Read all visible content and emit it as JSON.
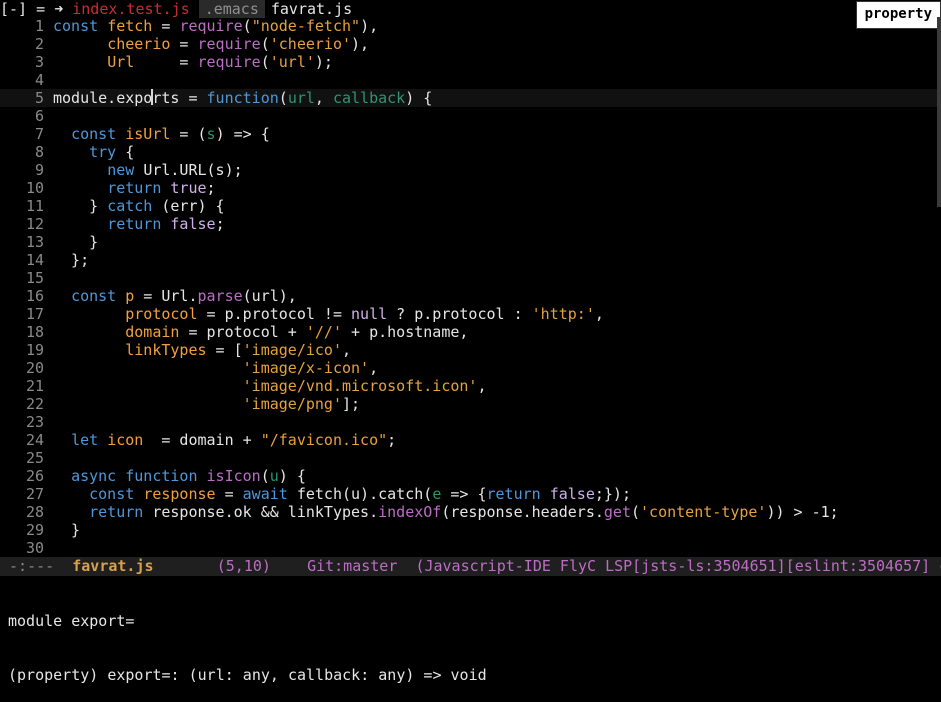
{
  "tabs": {
    "prefix": "[-] = ",
    "arrow": "➜",
    "items": [
      {
        "label": "index.test.js",
        "state": "modified"
      },
      {
        "label": ".emacs",
        "state": "inactive"
      },
      {
        "label": "favrat.js",
        "state": "current"
      }
    ]
  },
  "tooltip": {
    "text": "property"
  },
  "editor": {
    "current_line": 5,
    "line_numbers": [
      "1",
      "2",
      "3",
      "4",
      "5",
      "6",
      "7",
      "8",
      "9",
      "10",
      "11",
      "12",
      "13",
      "14",
      "15",
      "16",
      "17",
      "18",
      "19",
      "20",
      "21",
      "22",
      "23",
      "24",
      "25",
      "26",
      "27",
      "28",
      "29",
      "30"
    ],
    "lines": [
      [
        [
          "k",
          "const "
        ],
        [
          "v",
          "fetch"
        ],
        [
          "c",
          " = "
        ],
        [
          "f",
          "require"
        ],
        [
          "c",
          "("
        ],
        [
          "s",
          "\"node-fetch\""
        ],
        [
          "c",
          "),"
        ]
      ],
      [
        [
          "c",
          "      "
        ],
        [
          "v",
          "cheerio"
        ],
        [
          "c",
          " = "
        ],
        [
          "f",
          "require"
        ],
        [
          "c",
          "("
        ],
        [
          "s",
          "'cheerio'"
        ],
        [
          "c",
          "),"
        ]
      ],
      [
        [
          "c",
          "      "
        ],
        [
          "v",
          "Url"
        ],
        [
          "c",
          "     = "
        ],
        [
          "f",
          "require"
        ],
        [
          "c",
          "("
        ],
        [
          "s",
          "'url'"
        ],
        [
          "c",
          ");"
        ]
      ],
      [],
      [
        [
          "c",
          "module.expo"
        ],
        [
          "cursor",
          ""
        ],
        [
          "c",
          "rts = "
        ],
        [
          "k",
          "function"
        ],
        [
          "c",
          "("
        ],
        [
          "p",
          "url"
        ],
        [
          "c",
          ", "
        ],
        [
          "p",
          "callback"
        ],
        [
          "c",
          ") {"
        ]
      ],
      [],
      [
        [
          "c",
          "  "
        ],
        [
          "k",
          "const "
        ],
        [
          "v",
          "isUrl"
        ],
        [
          "c",
          " = ("
        ],
        [
          "p",
          "s"
        ],
        [
          "c",
          ") => {"
        ]
      ],
      [
        [
          "c",
          "    "
        ],
        [
          "k",
          "try"
        ],
        [
          "c",
          " {"
        ]
      ],
      [
        [
          "c",
          "      "
        ],
        [
          "k",
          "new "
        ],
        [
          "c",
          "Url.URL(s);"
        ]
      ],
      [
        [
          "c",
          "      "
        ],
        [
          "k",
          "return "
        ],
        [
          "kd",
          "true"
        ],
        [
          "c",
          ";"
        ]
      ],
      [
        [
          "c",
          "    } "
        ],
        [
          "k",
          "catch"
        ],
        [
          "c",
          " (err) {"
        ]
      ],
      [
        [
          "c",
          "      "
        ],
        [
          "k",
          "return "
        ],
        [
          "kd",
          "false"
        ],
        [
          "c",
          ";"
        ]
      ],
      [
        [
          "c",
          "    }"
        ]
      ],
      [
        [
          "c",
          "  };"
        ]
      ],
      [],
      [
        [
          "c",
          "  "
        ],
        [
          "k",
          "const "
        ],
        [
          "v",
          "p"
        ],
        [
          "c",
          " = Url."
        ],
        [
          "f",
          "parse"
        ],
        [
          "c",
          "(url),"
        ]
      ],
      [
        [
          "c",
          "        "
        ],
        [
          "v",
          "protocol"
        ],
        [
          "c",
          " = p.protocol != "
        ],
        [
          "kd",
          "null"
        ],
        [
          "c",
          " ? p.protocol : "
        ],
        [
          "s",
          "'http:'"
        ],
        [
          "c",
          ","
        ]
      ],
      [
        [
          "c",
          "        "
        ],
        [
          "v",
          "domain"
        ],
        [
          "c",
          " = protocol + "
        ],
        [
          "s",
          "'//'"
        ],
        [
          "c",
          " + p.hostname,"
        ]
      ],
      [
        [
          "c",
          "        "
        ],
        [
          "v",
          "linkTypes"
        ],
        [
          "c",
          " = ["
        ],
        [
          "s",
          "'image/ico'"
        ],
        [
          "c",
          ","
        ]
      ],
      [
        [
          "c",
          "                     "
        ],
        [
          "s",
          "'image/x-icon'"
        ],
        [
          "c",
          ","
        ]
      ],
      [
        [
          "c",
          "                     "
        ],
        [
          "s",
          "'image/vnd.microsoft.icon'"
        ],
        [
          "c",
          ","
        ]
      ],
      [
        [
          "c",
          "                     "
        ],
        [
          "s",
          "'image/png'"
        ],
        [
          "c",
          "];"
        ]
      ],
      [],
      [
        [
          "c",
          "  "
        ],
        [
          "k",
          "let "
        ],
        [
          "v",
          "icon"
        ],
        [
          "c",
          "  = domain + "
        ],
        [
          "s",
          "\"/favicon.ico\""
        ],
        [
          "c",
          ";"
        ]
      ],
      [],
      [
        [
          "c",
          "  "
        ],
        [
          "k",
          "async function "
        ],
        [
          "f",
          "isIcon"
        ],
        [
          "c",
          "("
        ],
        [
          "p",
          "u"
        ],
        [
          "c",
          ") {"
        ]
      ],
      [
        [
          "c",
          "    "
        ],
        [
          "k",
          "const "
        ],
        [
          "v",
          "response"
        ],
        [
          "c",
          " = "
        ],
        [
          "k",
          "await "
        ],
        [
          "c",
          "fetch(u).catch("
        ],
        [
          "p",
          "e"
        ],
        [
          "c",
          " => {"
        ],
        [
          "k",
          "return "
        ],
        [
          "kd",
          "false"
        ],
        [
          "c",
          ";});"
        ]
      ],
      [
        [
          "c",
          "    "
        ],
        [
          "k",
          "return "
        ],
        [
          "c",
          "response.ok && linkTypes."
        ],
        [
          "f",
          "indexOf"
        ],
        [
          "c",
          "(response.headers."
        ],
        [
          "f",
          "get"
        ],
        [
          "c",
          "("
        ],
        [
          "s",
          "'content-type'"
        ],
        [
          "c",
          ")) > -1;"
        ]
      ],
      [
        [
          "c",
          "  }"
        ]
      ],
      []
    ]
  },
  "modeline": {
    "state": "-:---",
    "filename": "favrat.js",
    "position": "(5,10)",
    "git": "Git:master",
    "modes": "(Javascript-IDE FlyC LSP[jsts-ls:3504651][eslint:3504657] c"
  },
  "echo": {
    "line1": "module export=",
    "line2": "(property) export=: (url: any, callback: any) => void"
  }
}
